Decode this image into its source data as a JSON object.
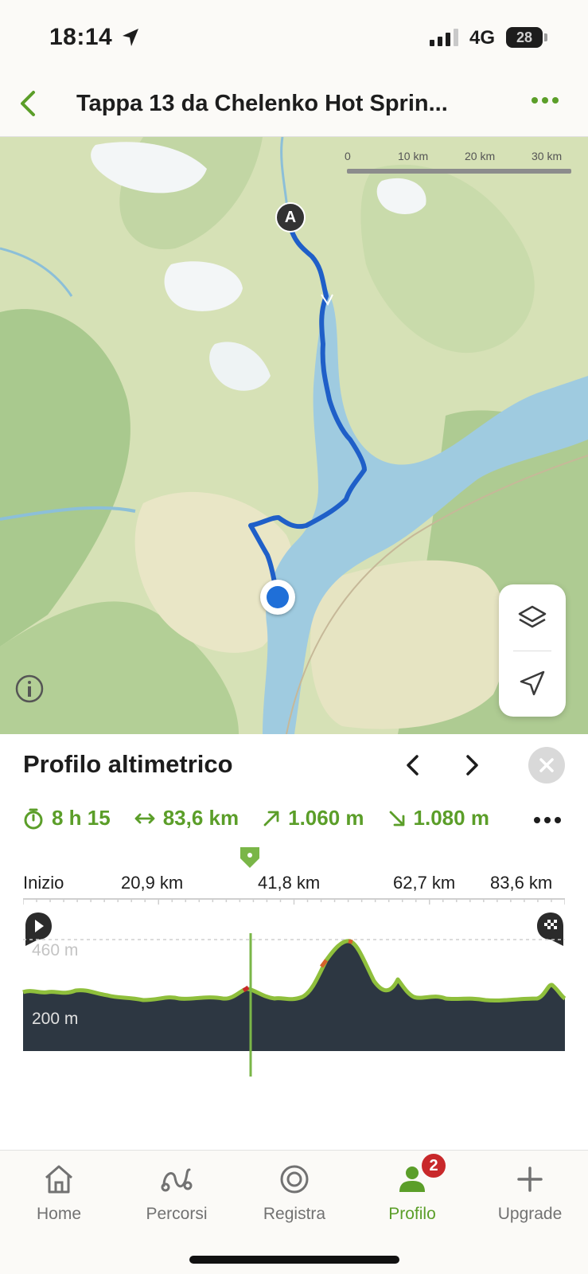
{
  "status_bar": {
    "time": "18:14",
    "network": "4G",
    "battery": "28"
  },
  "header": {
    "title": "Tappa 13 da Chelenko Hot Sprin..."
  },
  "map": {
    "scale": [
      "0",
      "10 km",
      "20 km",
      "30 km"
    ],
    "start_marker": "A"
  },
  "profile": {
    "title": "Profilo altimetrico",
    "stats": {
      "duration": "8 h 15",
      "distance": "83,6 km",
      "ascent": "1.060 m",
      "descent": "1.080 m"
    },
    "axis": [
      "Inizio",
      "20,9 km",
      "41,8 km",
      "62,7 km",
      "83,6 km"
    ],
    "elevation_labels": [
      "460 m",
      "200 m"
    ],
    "cursor_km": 41.8
  },
  "tabs": [
    {
      "label": "Home",
      "icon": "home-icon"
    },
    {
      "label": "Percorsi",
      "icon": "routes-icon"
    },
    {
      "label": "Registra",
      "icon": "record-icon"
    },
    {
      "label": "Profilo",
      "icon": "profile-icon",
      "badge": "2",
      "active": true
    },
    {
      "label": "Upgrade",
      "icon": "plus-icon"
    }
  ],
  "colors": {
    "accent": "#5b9e29",
    "route": "#1f5fc8",
    "water": "#9fcbe0",
    "badge": "#c8282a"
  }
}
